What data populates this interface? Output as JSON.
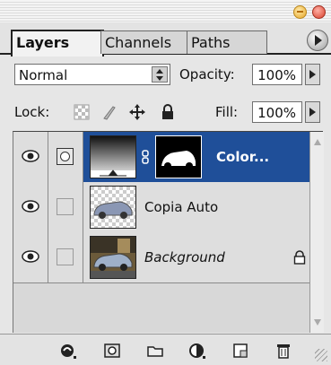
{
  "tabs": [
    {
      "label": "Layers",
      "active": true
    },
    {
      "label": "Channels",
      "active": false
    },
    {
      "label": "Paths",
      "active": false
    }
  ],
  "blend": {
    "mode": "Normal"
  },
  "opacity": {
    "label": "Opacity:",
    "value": "100%"
  },
  "lock": {
    "label": "Lock:"
  },
  "fill": {
    "label": "Fill:",
    "value": "100%"
  },
  "layers": [
    {
      "name": "Color...",
      "selected": true,
      "visible": true,
      "adjustment": true,
      "locked": false
    },
    {
      "name": "Copia Auto",
      "selected": false,
      "visible": true,
      "adjustment": false,
      "locked": false
    },
    {
      "name": "Background",
      "selected": false,
      "visible": true,
      "adjustment": false,
      "locked": true
    }
  ],
  "colors": {
    "selection": "#1f4f99",
    "panel": "#e6e6e6"
  },
  "icons": [
    "eye-icon",
    "layer-mask-icon",
    "link-chain-icon",
    "lock-icon",
    "add-style-icon",
    "add-mask-icon",
    "new-group-icon",
    "adjustment-layer-icon",
    "new-layer-icon",
    "trash-icon"
  ]
}
